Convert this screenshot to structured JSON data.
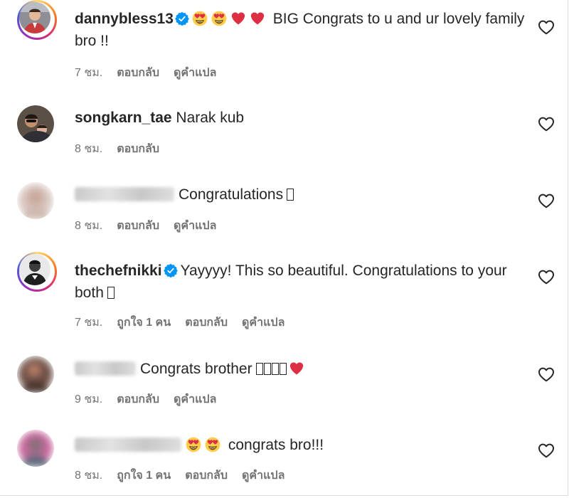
{
  "comments": [
    {
      "username": "dannybless13",
      "verified": true,
      "text": "BIG Congrats to u and ur lovely family bro !!",
      "time": "7 ชม.",
      "reply": "ตอบกลับ",
      "translate": "ดูคำแปล"
    },
    {
      "username": "songkarn_tae",
      "verified": false,
      "text": "Narak kub",
      "time": "8 ชม.",
      "reply": "ตอบกลับ"
    },
    {
      "username_blurred": true,
      "text": "Congratulations",
      "time": "8 ชม.",
      "reply": "ตอบกลับ",
      "translate": "ดูคำแปล"
    },
    {
      "username": "thechefnikki",
      "verified": true,
      "text": "Yayyyy! This so beautiful. Congratulations to your both",
      "time": "7 ชม.",
      "likes": "ถูกใจ 1 คน",
      "reply": "ตอบกลับ",
      "translate": "ดูคำแปล"
    },
    {
      "username_blurred": true,
      "text": "Congrats brother",
      "time": "9 ชม.",
      "reply": "ตอบกลับ",
      "translate": "ดูคำแปล"
    },
    {
      "username_blurred": true,
      "text": "congrats bro!!!",
      "time": "8 ชม.",
      "likes": "ถูกใจ 1 คน",
      "reply": "ตอบกลับ",
      "translate": "ดูคำแปล"
    }
  ],
  "icons": {
    "like": "heart-outline-icon",
    "verified": "verified-badge-icon",
    "emoji_heart_eyes": "heart-eyes-emoji",
    "emoji_red_heart": "red-heart-emoji"
  },
  "colors": {
    "text": "#262626",
    "secondary": "#737373",
    "verified": "#0095f6",
    "heart": "#ed1c24"
  }
}
